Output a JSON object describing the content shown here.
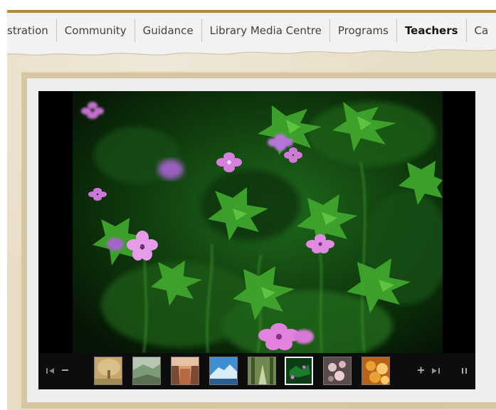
{
  "nav": {
    "items": [
      {
        "label": "stration",
        "active": false
      },
      {
        "label": "Community",
        "active": false
      },
      {
        "label": "Guidance",
        "active": false
      },
      {
        "label": "Library Media Centre",
        "active": false
      },
      {
        "label": "Programs",
        "active": false
      },
      {
        "label": "Teachers",
        "active": true
      },
      {
        "label": "Ca",
        "active": false
      }
    ]
  },
  "slideshow": {
    "controls": {
      "first_icon": "skip-to-first-icon",
      "zoom_out_icon": "minus-icon",
      "zoom_in_icon": "plus-icon",
      "last_icon": "skip-to-last-icon",
      "pause_icon": "pause-icon"
    },
    "thumbnails": [
      {
        "name": "autumn-tree",
        "colors": [
          "#c9a76a",
          "#7f6a3a",
          "#d8c08a"
        ]
      },
      {
        "name": "green-valley",
        "colors": [
          "#7d9a78",
          "#b8c7b0",
          "#5c6e52"
        ]
      },
      {
        "name": "canyon",
        "colors": [
          "#b56a44",
          "#d99b73",
          "#7a4a33"
        ]
      },
      {
        "name": "glacier",
        "colors": [
          "#3f8fd1",
          "#d8ecf8",
          "#2a5d92"
        ]
      },
      {
        "name": "forest-path",
        "colors": [
          "#6f8a4c",
          "#c9d5a9",
          "#3f522b"
        ]
      },
      {
        "name": "wildflowers",
        "colors": [
          "#1b7d2c",
          "#0c3d15",
          "#c67ad1"
        ]
      },
      {
        "name": "blossoms",
        "colors": [
          "#9c8a8a",
          "#e0c4cc",
          "#5a4b4b"
        ]
      },
      {
        "name": "orange-flowers",
        "colors": [
          "#e8a133",
          "#f7c96c",
          "#b8621c"
        ]
      }
    ],
    "active_index": 5
  },
  "theme": {
    "gold": "#b58a2a",
    "parchment": "#e7dcc4",
    "frame": "#d6c6a2"
  }
}
